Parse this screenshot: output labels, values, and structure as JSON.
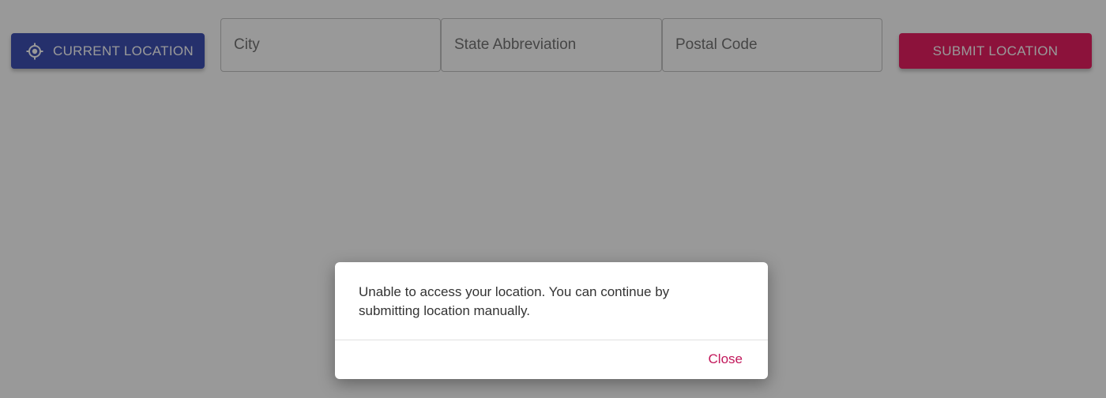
{
  "toolbar": {
    "current_location_label": "CURRENT LOCATION",
    "current_location_icon": "crosshair-gps-icon",
    "submit_label": "SUBMIT LOCATION"
  },
  "fields": {
    "city_placeholder": "City",
    "state_placeholder": "State Abbreviation",
    "postal_placeholder": "Postal Code"
  },
  "dialog": {
    "message": "Unable to access your location. You can continue by submitting location manually.",
    "close_label": "Close"
  },
  "colors": {
    "primary": "#3f51b5",
    "accent": "#e91e63",
    "overlay": "rgba(0,0,0,0.4)"
  }
}
